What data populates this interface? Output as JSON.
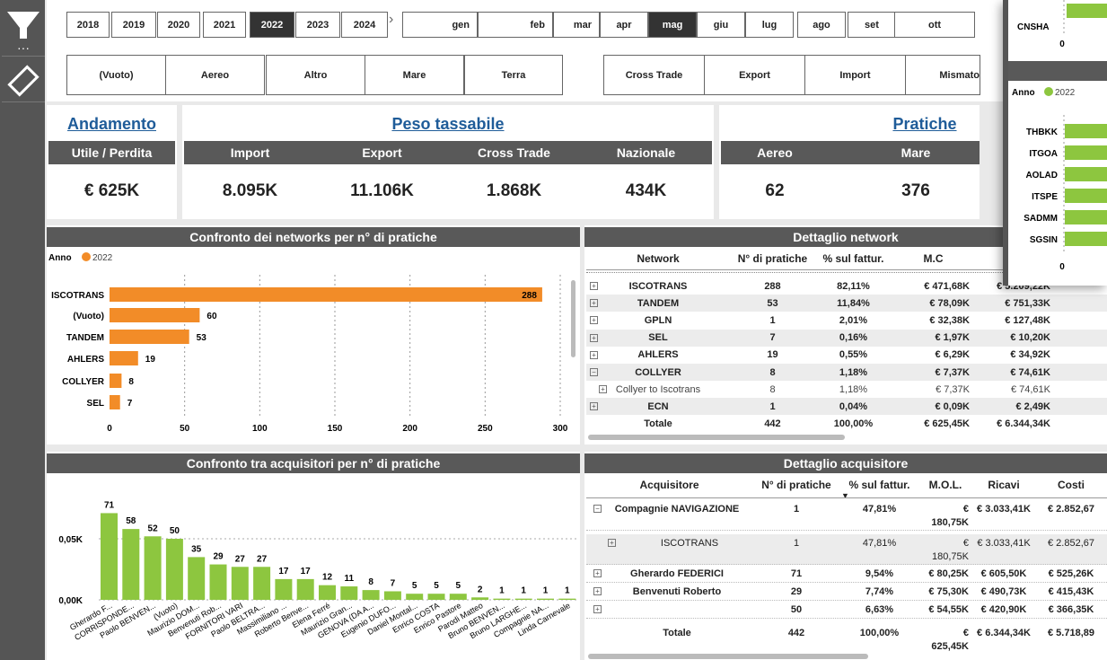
{
  "years": [
    "2018",
    "2019",
    "2020",
    "2021",
    "2022",
    "2023",
    "2024"
  ],
  "months": [
    "gen",
    "feb",
    "mar",
    "apr",
    "mag",
    "giu",
    "lug",
    "ago",
    "set",
    "ott"
  ],
  "selected_year": "2022",
  "selected_month": "mag",
  "types1": [
    "(Vuoto)",
    "Aereo",
    "Altro",
    "Mare",
    "Terra"
  ],
  "types2": [
    "Cross Trade",
    "Export",
    "Import",
    "Mismato"
  ],
  "kpi": {
    "andamento": "Andamento",
    "utile_label": "Utile / Perdita",
    "utile": "€ 625K",
    "peso": "Peso tassabile",
    "import_l": "Import",
    "import": "8.095K",
    "export_l": "Export",
    "export": "11.106K",
    "cross_l": "Cross Trade",
    "cross": "1.868K",
    "naz_l": "Nazionale",
    "naz": "434K",
    "pratiche": "Pratiche",
    "aereo_l": "Aereo",
    "aereo": "62",
    "mare_l": "Mare",
    "mare": "376"
  },
  "chart_data": [
    {
      "type": "bar",
      "title": "Confronto dei networks per n° di pratiche",
      "legend_title": "Anno",
      "legend": "2022",
      "color": "#f28c28",
      "categories": [
        "ISCOTRANS",
        "(Vuoto)",
        "TANDEM",
        "AHLERS",
        "COLLYER",
        "SEL"
      ],
      "values": [
        288,
        60,
        53,
        19,
        8,
        7
      ],
      "xlim": [
        0,
        300
      ],
      "ticks": [
        "0",
        "50",
        "100",
        "150",
        "200",
        "250",
        "300"
      ]
    },
    {
      "type": "bar",
      "title": "Confronto tra acquisitori per n° di pratiche",
      "color": "#8dc63f",
      "categories": [
        "Gherardo F...",
        "CORRISPONDE...",
        "Paolo BENVEN...",
        "(Vuoto)",
        "Maurizio DOM...",
        "Benvenuti Rob...",
        "FORNITORI VARI",
        "Paolo BELTRA...",
        "Massimiliano ...",
        "Roberto Benve...",
        "Elena Ferré",
        "Maurizio Gran...",
        "GENOVA (DA A...",
        "Eugenio DUFO...",
        "Daniel Montal...",
        "Enrico COSTA",
        "Enrico Pastore",
        "Parodi Matteo",
        "Bruno BENVEN...",
        "Bruno LARGHE...",
        "Compagnie NA...",
        "Linda Carnevale"
      ],
      "values": [
        71,
        58,
        52,
        50,
        35,
        29,
        27,
        27,
        17,
        17,
        12,
        11,
        8,
        7,
        5,
        5,
        5,
        2,
        1,
        1,
        1,
        1
      ],
      "yticks": [
        "0,00K",
        "0,05K"
      ]
    },
    {
      "type": "bar",
      "title": "",
      "legend_title": "Anno",
      "legend": "2022",
      "color": "#8dc63f",
      "categories": [
        "CNSHA",
        "THBKK",
        "ITGOA",
        "AOLAD",
        "ITSPE",
        "SADMM",
        "SGSIN"
      ],
      "ticks": [
        "0"
      ]
    }
  ],
  "network": {
    "title": "Dettaglio network",
    "headers": [
      "Network",
      "N° di pratiche",
      "% sul fattur.",
      "M.C"
    ],
    "rows": [
      [
        "ISCOTRANS",
        "288",
        "82,11%",
        "€ 471,68K",
        "€ 5.209,22K"
      ],
      [
        "TANDEM",
        "53",
        "11,84%",
        "€ 78,09K",
        "€ 751,33K"
      ],
      [
        "GPLN",
        "1",
        "2,01%",
        "€ 32,38K",
        "€ 127,48K"
      ],
      [
        "SEL",
        "7",
        "0,16%",
        "€ 1,97K",
        "€ 10,20K"
      ],
      [
        "AHLERS",
        "19",
        "0,55%",
        "€ 6,29K",
        "€ 34,92K"
      ],
      [
        "COLLYER",
        "8",
        "1,18%",
        "€ 7,37K",
        "€ 74,61K"
      ],
      [
        "Collyer to Iscotrans",
        "8",
        "1,18%",
        "€ 7,37K",
        "€ 74,61K"
      ],
      [
        "ECN",
        "1",
        "0,04%",
        "€ 0,09K",
        "€ 2,49K"
      ],
      [
        "Totale",
        "442",
        "100,00%",
        "€ 625,45K",
        "€ 6.344,34K"
      ]
    ]
  },
  "acq": {
    "title": "Dettaglio acquisitore",
    "headers": [
      "Acquisitore",
      "N° di pratiche",
      "% sul fattur.",
      "M.O.L.",
      "Ricavi",
      "Costi"
    ],
    "rows": [
      [
        "Compagnie NAVIGAZIONE",
        "1",
        "47,81%",
        "€",
        "180,75K",
        "€ 3.033,41K",
        "€ 2.852,67"
      ],
      [
        "ISCOTRANS",
        "1",
        "47,81%",
        "€",
        "180,75K",
        "€ 3.033,41K",
        "€ 2.852,67"
      ],
      [
        "Gherardo FEDERICI",
        "71",
        "9,54%",
        "€ 80,25K",
        "",
        "€ 605,50K",
        "€ 525,26K"
      ],
      [
        "Benvenuti Roberto",
        "29",
        "7,74%",
        "€ 75,30K",
        "",
        "€ 490,73K",
        "€ 415,43K"
      ],
      [
        "",
        "50",
        "6,63%",
        "€ 54,55K",
        "",
        "€ 420,90K",
        "€ 366,35K"
      ],
      [
        "Totale",
        "442",
        "100,00%",
        "€",
        "625,45K",
        "€ 6.344,34K",
        "€ 5.718,89"
      ]
    ]
  }
}
